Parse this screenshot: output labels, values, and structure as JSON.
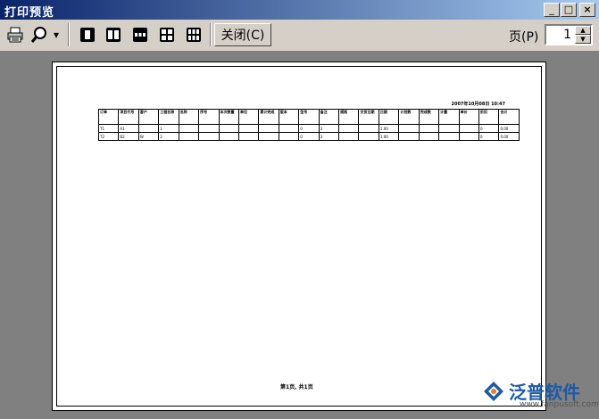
{
  "window": {
    "title": "打印预览",
    "minimize": "_",
    "maximize": "□",
    "close": "×"
  },
  "toolbar": {
    "print_icon": "printer-icon",
    "zoom_icon": "magnifier-icon",
    "zoom_arrow": "▾",
    "layouts": [
      "one-page-icon",
      "two-page-icon",
      "three-page-icon",
      "four-page-icon",
      "six-page-icon"
    ],
    "close_label": "关闭(C)",
    "page_label": "页(P)",
    "page_value": "1",
    "spin_up": "▲",
    "spin_down": "▼"
  },
  "report": {
    "print_date": "2007年10月08日 10:47",
    "headers": [
      "订单",
      "项目代号",
      "客户",
      "工程名称",
      "名称",
      "序号",
      "本次数量",
      "单位",
      "累计完成",
      "版本",
      "型号",
      "备注",
      "规格",
      "交货日期",
      "日期",
      "计划数",
      "完成数",
      "计量",
      "单价",
      "折扣",
      "合计"
    ],
    "rows": [
      [
        "T1",
        "A1",
        "",
        "1",
        "",
        "",
        "",
        "",
        "",
        "",
        "0",
        "3",
        "",
        "",
        "1.00",
        "",
        "",
        "",
        "",
        "0",
        "0.00"
      ],
      [
        "T2",
        "B2",
        "W",
        "2",
        "",
        "",
        "",
        "",
        "",
        "",
        "0",
        "3",
        "",
        "",
        "1.00",
        "",
        "",
        "",
        "",
        "0",
        "0.00"
      ]
    ],
    "page_footer": "第1页, 共1页"
  },
  "watermark": {
    "brand": "泛普软件",
    "url": "www.fanpusoft.com",
    "logo_icon": "fanpu-logo-icon"
  }
}
